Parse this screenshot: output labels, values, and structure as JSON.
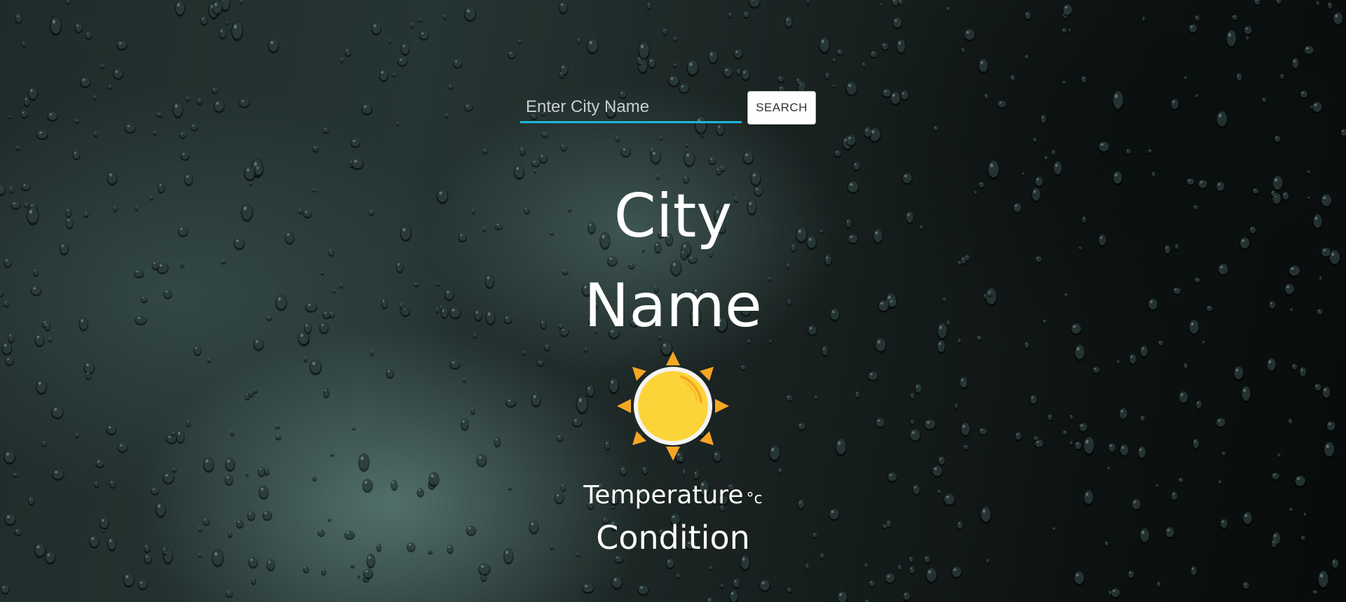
{
  "search": {
    "placeholder": "Enter City Name",
    "value": "",
    "button_label": "SEARCH"
  },
  "weather": {
    "city": "City Name",
    "icon": "sun-icon",
    "temperature_label": "Temperature",
    "temperature_unit": "°c",
    "condition": "Condition"
  },
  "colors": {
    "input_underline": "#1fb6d9",
    "sun_core": "#fbd43a",
    "sun_rays": "#f6a623"
  }
}
